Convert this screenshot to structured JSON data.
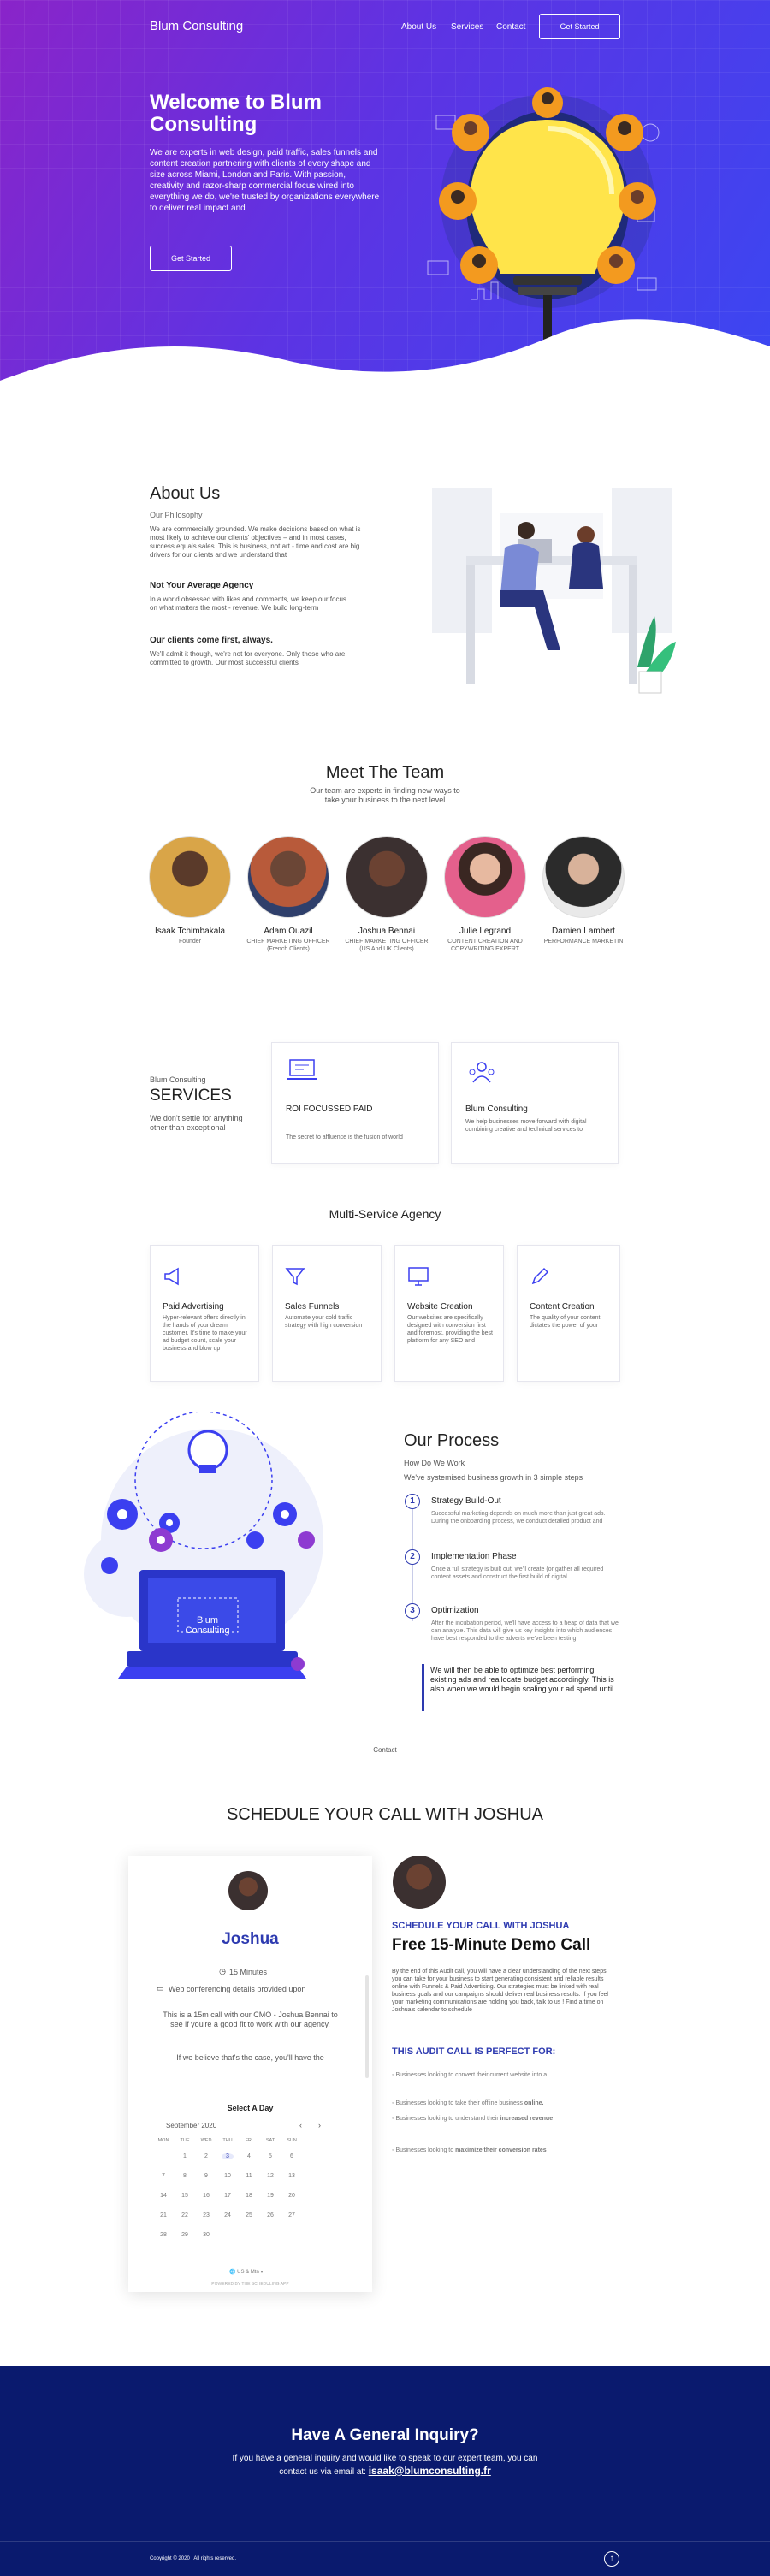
{
  "header": {
    "brand": "Blum Consulting",
    "nav": [
      "About Us",
      "Services",
      "Contact"
    ],
    "cta": "Get Started"
  },
  "hero": {
    "title": "Welcome to Blum Consulting",
    "text": "We are experts in web design, paid traffic, sales funnels and content creation partnering with clients of every shape and size across Miami, London and Paris. With passion, creativity and razor-sharp commercial focus wired into everything we do, we're trusted by organizations everywhere to deliver real impact and",
    "cta": "Get Started"
  },
  "about": {
    "title": "About Us",
    "subtitle": "Our Philosophy",
    "text": "We are commercially grounded. We make decisions based on what is most likely to achieve our clients' objectives – and in most cases, success equals sales. This is business, not art - time and cost are big drivers for our clients and we understand that",
    "h2": "Not Your Average Agency",
    "text2": "In a world obsessed with likes and comments, we keep our focus on what matters the most - revenue. We build long-term",
    "h3": "Our clients come first, always.",
    "text3": "We'll admit it though, we're not for everyone. Only those who are committed to growth. Our most successful clients"
  },
  "team": {
    "title": "Meet The Team",
    "subtitle": "Our team are experts in finding new ways to take your business to the next level",
    "members": [
      {
        "name": "Isaak Tchimbakala",
        "role": "Founder"
      },
      {
        "name": "Adam Ouazil",
        "role": "CHIEF MARKETING OFFICER (French Clients)"
      },
      {
        "name": "Joshua Bennai",
        "role": "CHIEF MARKETING OFFICER (US And UK Clients)"
      },
      {
        "name": "Julie Legrand",
        "role": "CONTENT CREATION AND COPYWRITING EXPERT"
      },
      {
        "name": "Damien Lambert",
        "role": "PERFORMANCE MARKETIN"
      }
    ]
  },
  "services": {
    "kicker": "Blum Consulting",
    "title": "SERVICES",
    "text": "We don't settle for anything other than exceptional",
    "cards": [
      {
        "title": "ROI FOCUSSED PAID",
        "text": "The secret to affluence is the fusion of world"
      },
      {
        "title": "Blum Consulting",
        "text": "We help businesses move forward with digital combining creative and technical services to"
      }
    ]
  },
  "multi": {
    "title": "Multi-Service Agency",
    "cards": [
      {
        "title": "Paid Advertising",
        "text": "Hyper-relevant offers directly in the hands of your dream customer. It's time to make your ad budget count, scale your business and blow up"
      },
      {
        "title": "Sales Funnels",
        "text": "Automate your cold traffic strategy with high conversion"
      },
      {
        "title": "Website Creation",
        "text": "Our websites are specifically designed with conversion first and foremost, providing the best platform for any SEO and"
      },
      {
        "title": "Content Creation",
        "text": "The quality of your content dictates the power of your"
      }
    ]
  },
  "process": {
    "title": "Our Process",
    "subtitle": "How Do We Work",
    "intro": "We've systemised business growth in 3 simple steps",
    "illus_label": "Blum Consulting",
    "steps": [
      {
        "n": "1",
        "title": "Strategy Build-Out",
        "text": "Successful marketing depends on much more than just great ads. During the onboarding process, we conduct detailed product and"
      },
      {
        "n": "2",
        "title": "Implementation Phase",
        "text": "Once a full strategy is built out, we'll create (or gather all required content assets and construct the first build of digital"
      },
      {
        "n": "3",
        "title": "Optimization",
        "text": "After the incubation period, we'll have access to a heap of data that we can analyze. This data will give us key insights into which audiences have best responded to the adverts we've been testing"
      }
    ],
    "quote": "We will then be able to optimize best performing existing ads and reallocate budget accordingly. This is also when we would begin scaling your ad spend until"
  },
  "contact": {
    "kicker": "Contact",
    "title": "SCHEDULE YOUR CALL WITH JOSHUA"
  },
  "booking": {
    "name": "Joshua",
    "duration": "15 Minutes",
    "conf": "Web conferencing details provided upon",
    "desc1": "This is a 15m call with our CMO - Joshua Bennai to see if you're a good fit to work with our agency.",
    "desc2": "If we believe that's the case, you'll have the",
    "select": "Select A Day",
    "month": "September 2020",
    "days": [
      "MON",
      "TUE",
      "WED",
      "THU",
      "FRI",
      "SAT",
      "SUN"
    ],
    "dates": [
      "1",
      "2",
      "3",
      "4",
      "5",
      "6",
      "7",
      "8",
      "9",
      "10",
      "11",
      "12",
      "13",
      "14",
      "15",
      "16",
      "17",
      "18",
      "19",
      "20",
      "21",
      "22",
      "23",
      "24",
      "25",
      "26",
      "27",
      "28",
      "29",
      "30"
    ],
    "tz": "US & Mtn",
    "powered": "POWERED BY THE SCHEDULING APP"
  },
  "demo": {
    "kicker": "SCHEDULE YOUR CALL WITH JOSHUA",
    "title": "Free 15-Minute Demo Call",
    "text": "By the end of this Audit call, you will have a clear understanding of the next steps you can take for your business to start generating consistent and reliable results online with Funnels & Paid Advertising. Our strategies must be linked with real business goals and our campaigns should deliver real business results. If you feel your marketing communications are holding you back, talk to us ! Find a time on Joshua's calendar to schedule",
    "perfect": "THIS AUDIT CALL IS PERFECT FOR:",
    "items": [
      {
        "pre": "Businesses looking to convert their current website into a",
        "bold": ""
      },
      {
        "pre": "Businesses looking to take their offline business ",
        "bold": "online."
      },
      {
        "pre": "Businesses looking to understand their ",
        "bold": "increased revenue"
      },
      {
        "pre": "Businesses looking to ",
        "bold": "maximize their conversion rates"
      }
    ]
  },
  "inquiry": {
    "title": "Have A General Inquiry?",
    "text": "If you have a general inquiry and would like to speak to our expert team, you can contact us via email at:",
    "email": "isaak@blumconsulting.fr",
    "copyright": "Copyright © 2020 | All rights reserved."
  },
  "colors": {
    "accent": "#3b3ff0",
    "navy": "#0a1a6e",
    "purple": "#8a24c9"
  }
}
